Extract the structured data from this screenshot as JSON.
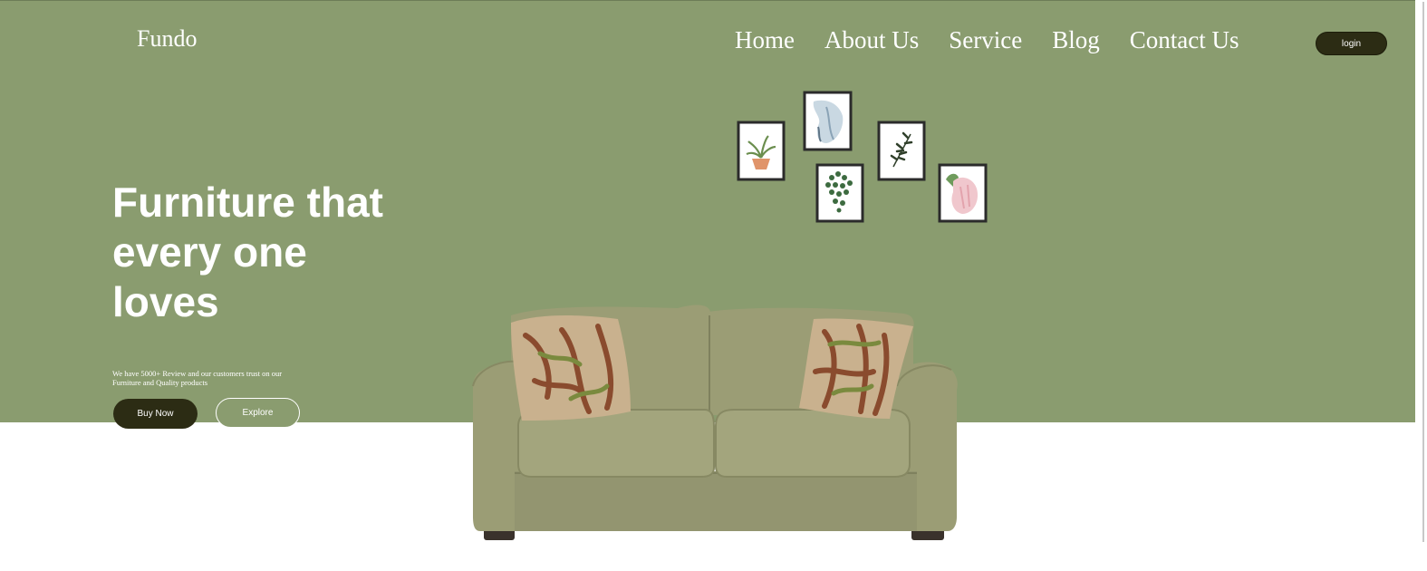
{
  "brand": {
    "name": "Fundo"
  },
  "nav": {
    "items": [
      {
        "label": "Home"
      },
      {
        "label": "About Us"
      },
      {
        "label": "Service"
      },
      {
        "label": "Blog"
      },
      {
        "label": "Contact Us"
      }
    ],
    "login_label": "login"
  },
  "hero": {
    "headline": "Furniture that every one loves",
    "subtext": "We have 5000+ Review and our customers trust on our Furniture and Quality products",
    "buy_label": "Buy Now",
    "explore_label": "Explore"
  },
  "colors": {
    "hero_background": "#8a9c6f",
    "dark_button": "#2c2c14",
    "sofa": "#9ea077",
    "frame": "#2b2b2b"
  },
  "images": {
    "wall_art": "framed-plant-prints-icon",
    "sofa": "green-sofa-illustration"
  }
}
